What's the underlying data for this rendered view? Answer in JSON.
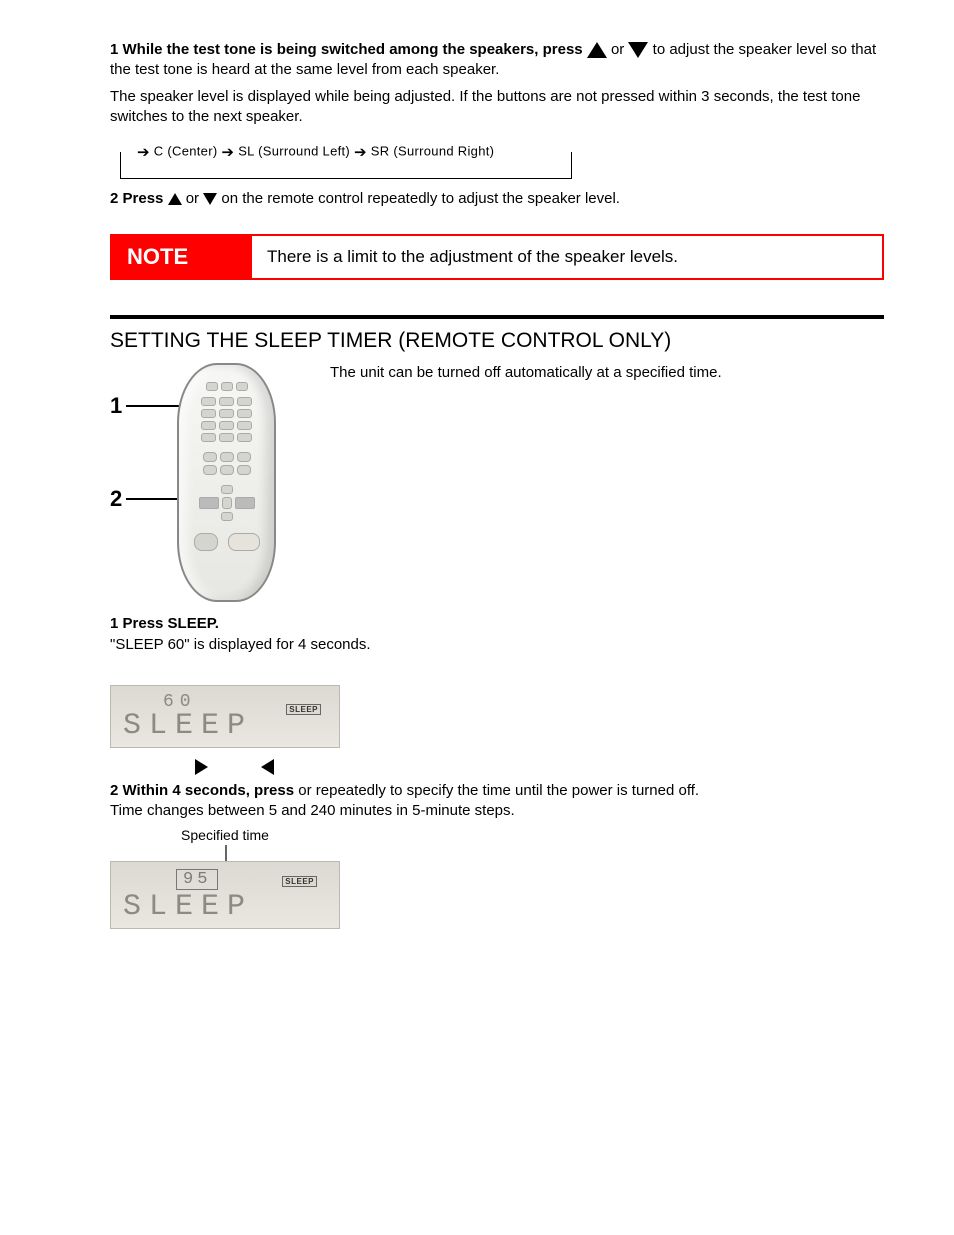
{
  "step1": {
    "prefix": "1 While the test tone is being switched among the speakers, press ",
    "or": " or ",
    "suffix1": " to adjust the speaker level so that the test tone is heard at the same level from each speaker.",
    "detail": "The speaker level is displayed while being adjusted. If the buttons are not pressed within 3 seconds, the test tone switches to the next speaker."
  },
  "channel_cycle": {
    "c": "C (Center)",
    "sl": "SL (Surround Left)",
    "sr": "SR (Surround Right)"
  },
  "step2": {
    "prefix": "2 Press ",
    "or": " or ",
    "suffix": " on the remote control repeatedly to adjust the speaker level."
  },
  "note": {
    "label": "NOTE",
    "text": "There is a limit to the adjustment of the speaker levels."
  },
  "sleep": {
    "title": "SETTING THE SLEEP TIMER (REMOTE CONTROL ONLY)",
    "intro": "The unit can be turned off automatically at a specified time.",
    "btn1_label": "1",
    "btn2_label": "2",
    "s1_a": "1 Press SLEEP.",
    "s1_b": "\"SLEEP 60\" is displayed for 4 seconds.",
    "display1_small": "60",
    "display1_badge": "SLEEP",
    "display1_big": "SLEEP",
    "s2_prefix": "2 Within 4 seconds, press ",
    "s2_or": " or ",
    "s2_suffix": " repeatedly to specify the time until the power is turned off.",
    "s2_detail": "Time changes between 5 and 240 minutes in 5-minute steps.",
    "caption": "Specified time",
    "display2_value": "95",
    "display2_badge": "SLEEP",
    "display2_big": "SLEEP"
  }
}
